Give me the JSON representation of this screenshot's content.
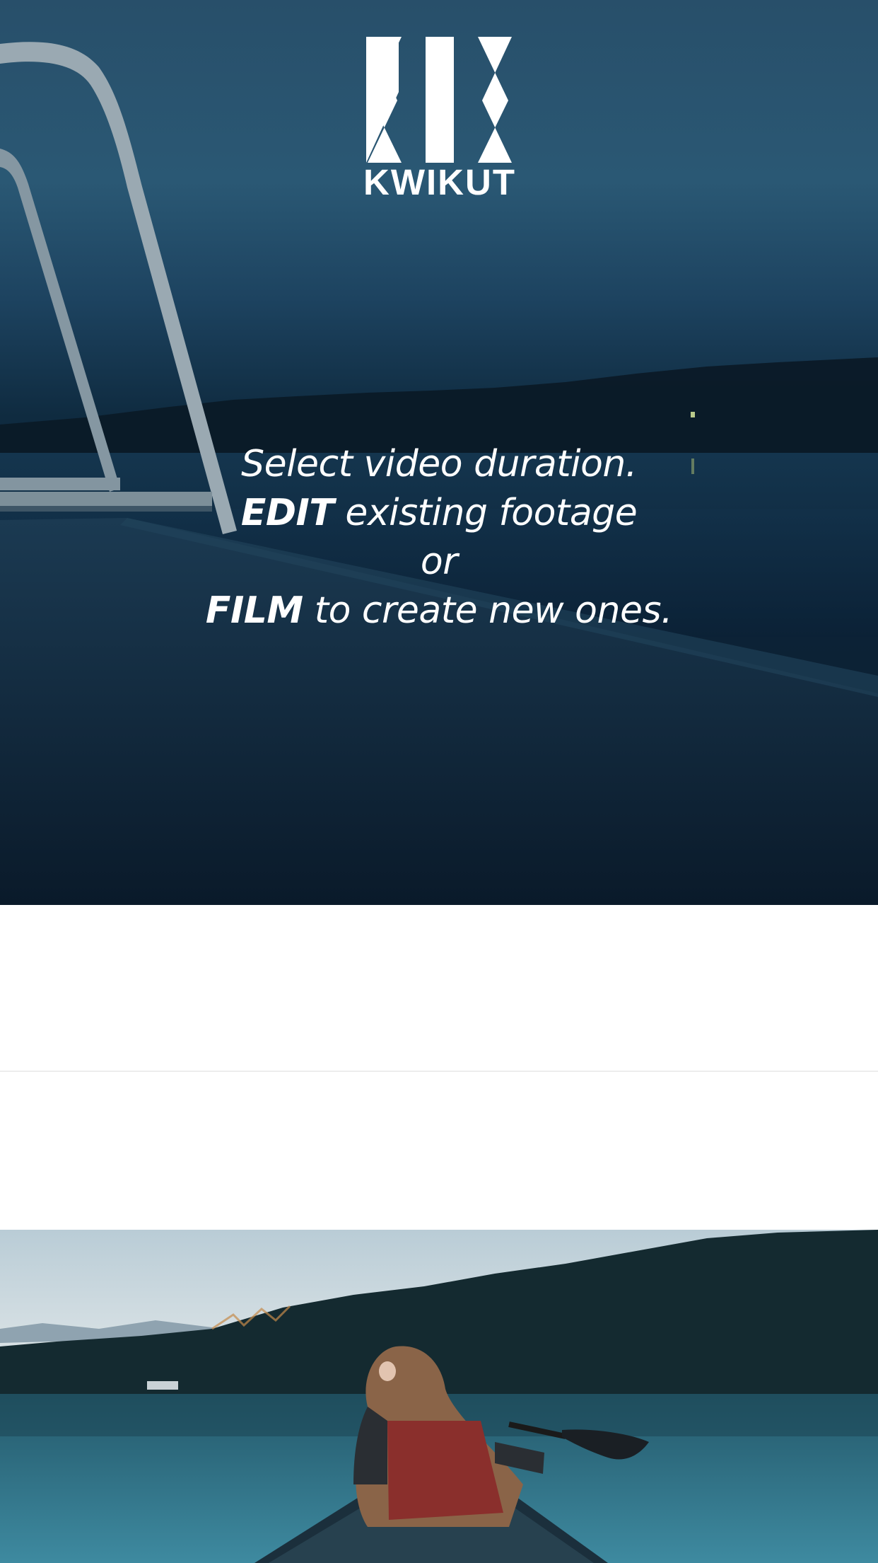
{
  "brand": {
    "name": "KWIKUT",
    "logo_icon": "kwikut-k-mark"
  },
  "hero": {
    "line1": "Select video duration.",
    "line2_bold": "EDIT",
    "line2_rest": " existing footage",
    "line3": "or",
    "line4_bold": "FILM",
    "line4_rest": " to create new ones."
  },
  "colors": {
    "hero_night": "#1d4360",
    "text": "#ffffff",
    "divider": "#ededed",
    "lake": "#2c6d80"
  }
}
